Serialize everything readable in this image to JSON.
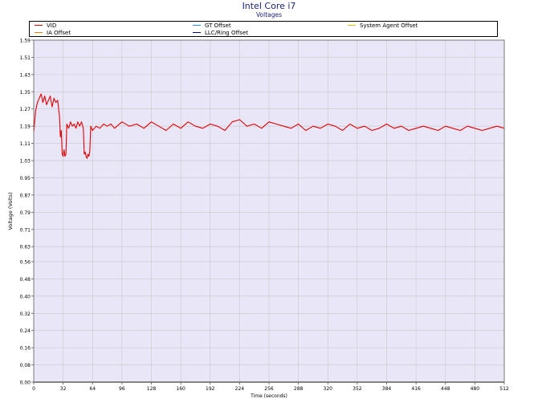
{
  "chart_title": "Intel Core i7",
  "chart_subtitle": "Voltages",
  "legend": [
    {
      "name": "VID",
      "color": "#e00000"
    },
    {
      "name": "GT Offset",
      "color": "#1e90ff"
    },
    {
      "name": "System Agent Offset",
      "color": "#c8c800"
    },
    {
      "name": "IA Offset",
      "color": "#e08000"
    },
    {
      "name": "LLC/Ring Offset",
      "color": "#000080"
    }
  ],
  "chart_data": {
    "type": "line",
    "title": "Intel Core i7",
    "subtitle": "Voltages",
    "xlabel": "Time (seconds)",
    "ylabel": "Voltage (Volts)",
    "xlim": [
      0,
      512
    ],
    "ylim": [
      0,
      1.59
    ],
    "x_ticks": [
      0,
      32,
      64,
      96,
      128,
      160,
      192,
      224,
      256,
      288,
      320,
      352,
      384,
      416,
      448,
      480,
      512
    ],
    "y_ticks": [
      "0.00",
      "0.08",
      "0.16",
      "0.24",
      "0.32",
      "0.40",
      "0.48",
      "0.56",
      "0.63",
      "0.71",
      "0.79",
      "0.87",
      "0.95",
      "1.03",
      "1.11",
      "1.19",
      "1.27",
      "1.35",
      "1.43",
      "1.51",
      "1.59"
    ],
    "grid": true,
    "legend_position": "top",
    "plot_background": "#e9e6f8",
    "series": [
      {
        "name": "VID",
        "color": "#e00000",
        "x": [
          0,
          2,
          4,
          6,
          8,
          10,
          12,
          14,
          16,
          18,
          20,
          22,
          24,
          26,
          28,
          29,
          30,
          31,
          32,
          33,
          34,
          35,
          36,
          38,
          40,
          42,
          44,
          46,
          48,
          50,
          52,
          54,
          55,
          56,
          57,
          58,
          59,
          60,
          61,
          62,
          64,
          68,
          72,
          76,
          80,
          84,
          88,
          96,
          104,
          112,
          120,
          128,
          136,
          144,
          152,
          160,
          168,
          176,
          184,
          192,
          200,
          208,
          216,
          224,
          232,
          240,
          248,
          256,
          264,
          272,
          280,
          288,
          296,
          304,
          312,
          320,
          328,
          336,
          344,
          352,
          360,
          368,
          376,
          384,
          392,
          400,
          408,
          416,
          424,
          432,
          440,
          448,
          456,
          464,
          472,
          480,
          488,
          496,
          504,
          512
        ],
        "y": [
          1.16,
          1.26,
          1.3,
          1.32,
          1.34,
          1.3,
          1.33,
          1.29,
          1.31,
          1.33,
          1.28,
          1.32,
          1.3,
          1.31,
          1.24,
          1.14,
          1.17,
          1.06,
          1.05,
          1.08,
          1.05,
          1.06,
          1.2,
          1.18,
          1.21,
          1.19,
          1.2,
          1.18,
          1.21,
          1.19,
          1.21,
          1.18,
          1.06,
          1.07,
          1.05,
          1.04,
          1.06,
          1.05,
          1.07,
          1.19,
          1.17,
          1.19,
          1.18,
          1.2,
          1.19,
          1.2,
          1.18,
          1.21,
          1.19,
          1.2,
          1.18,
          1.21,
          1.19,
          1.17,
          1.2,
          1.18,
          1.21,
          1.19,
          1.18,
          1.2,
          1.19,
          1.17,
          1.21,
          1.22,
          1.19,
          1.2,
          1.18,
          1.21,
          1.2,
          1.19,
          1.18,
          1.2,
          1.17,
          1.19,
          1.18,
          1.2,
          1.19,
          1.17,
          1.2,
          1.18,
          1.19,
          1.17,
          1.18,
          1.2,
          1.18,
          1.19,
          1.17,
          1.18,
          1.19,
          1.18,
          1.17,
          1.19,
          1.18,
          1.17,
          1.19,
          1.18,
          1.17,
          1.18,
          1.19,
          1.18
        ]
      },
      {
        "name": "GT Offset",
        "color": "#1e90ff",
        "x": [
          0,
          512
        ],
        "y": [
          0,
          0
        ]
      },
      {
        "name": "System Agent Offset",
        "color": "#c8c800",
        "x": [
          0,
          512
        ],
        "y": [
          0,
          0
        ]
      },
      {
        "name": "IA Offset",
        "color": "#e08000",
        "x": [
          0,
          512
        ],
        "y": [
          0,
          0
        ]
      },
      {
        "name": "LLC/Ring Offset",
        "color": "#000080",
        "x": [
          0,
          512
        ],
        "y": [
          0,
          0
        ]
      }
    ]
  }
}
